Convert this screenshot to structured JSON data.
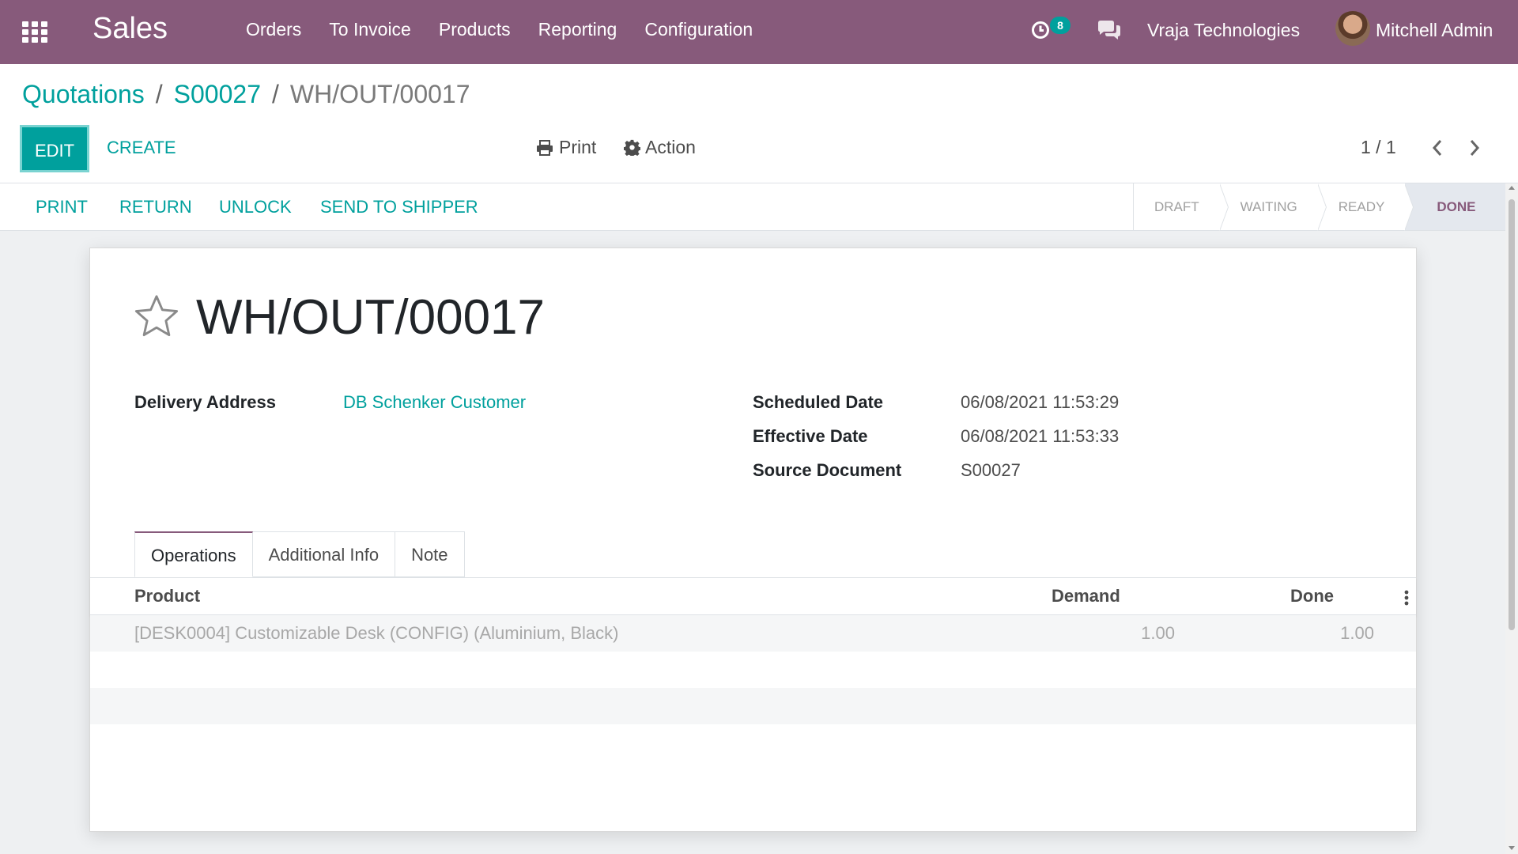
{
  "navbar": {
    "app_title": "Sales",
    "menu": [
      "Orders",
      "To Invoice",
      "Products",
      "Reporting",
      "Configuration"
    ],
    "activity_count": "8",
    "company": "Vraja Technologies",
    "user_name": "Mitchell Admin"
  },
  "breadcrumb": {
    "items": [
      "Quotations",
      "S00027"
    ],
    "separator": "/",
    "current": "WH/OUT/00017"
  },
  "control": {
    "edit_label": "EDIT",
    "create_label": "CREATE",
    "print_label": "Print",
    "action_label": "Action",
    "pager": "1 / 1"
  },
  "statusbar": {
    "buttons": [
      "PRINT",
      "RETURN",
      "UNLOCK",
      "SEND TO SHIPPER"
    ],
    "stages": [
      "DRAFT",
      "WAITING",
      "READY",
      "DONE"
    ],
    "current_stage": "DONE"
  },
  "record": {
    "title": "WH/OUT/00017",
    "delivery_address_label": "Delivery Address",
    "delivery_address": "DB Schenker Customer",
    "scheduled_date_label": "Scheduled Date",
    "scheduled_date": "06/08/2021 11:53:29",
    "effective_date_label": "Effective Date",
    "effective_date": "06/08/2021 11:53:33",
    "source_document_label": "Source Document",
    "source_document": "S00027"
  },
  "tabs": [
    "Operations",
    "Additional Info",
    "Note"
  ],
  "operations": {
    "columns": [
      "Product",
      "Demand",
      "Done"
    ],
    "rows": [
      {
        "product": "[DESK0004] Customizable Desk (CONFIG) (Aluminium, Black)",
        "demand": "1.00",
        "done": "1.00"
      }
    ]
  },
  "colors": {
    "brand": "#875a7b",
    "accent": "#00a09d"
  }
}
